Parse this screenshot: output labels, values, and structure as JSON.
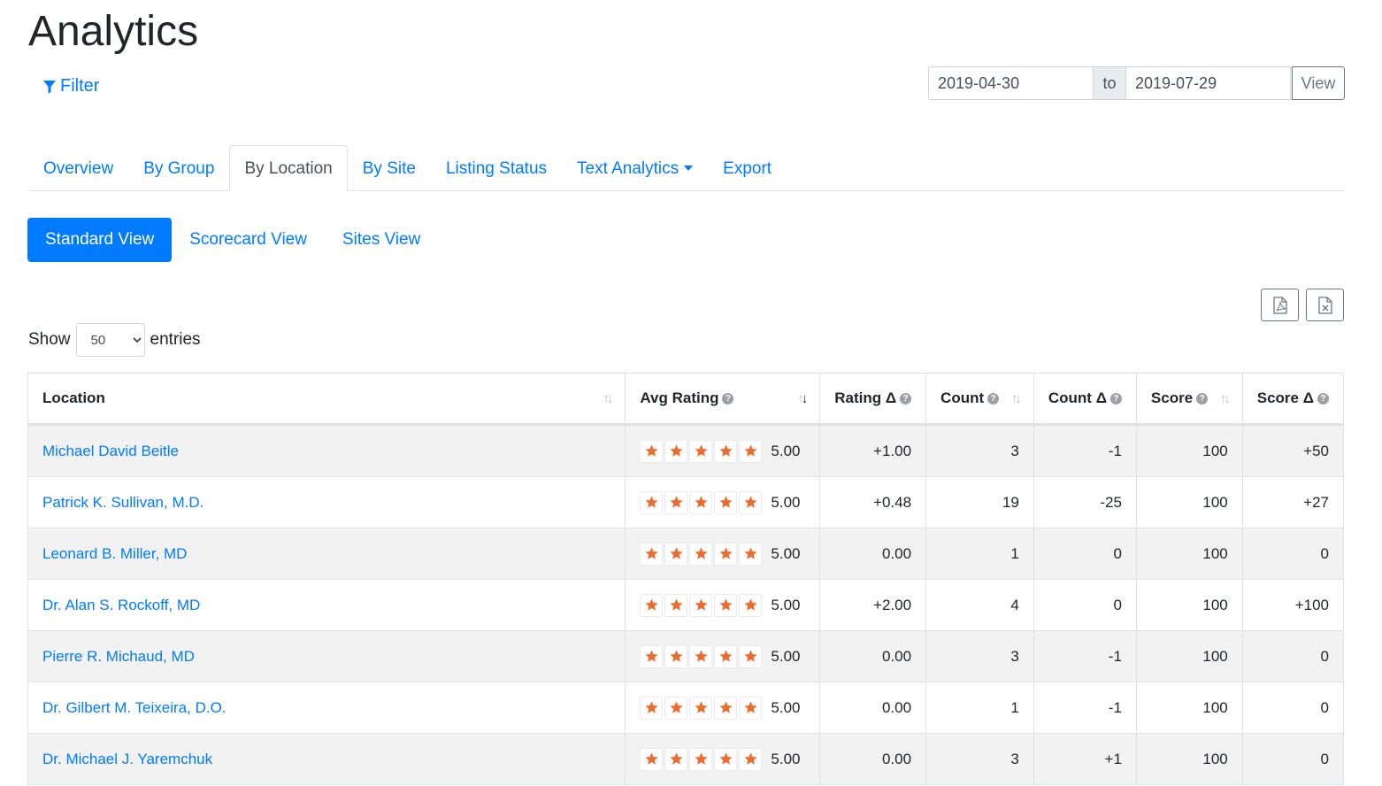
{
  "page": {
    "title": "Analytics",
    "filter_label": "Filter"
  },
  "date_range": {
    "start": "2019-04-30",
    "separator": "to",
    "end": "2019-07-29",
    "view_label": "View"
  },
  "tabs": [
    {
      "label": "Overview"
    },
    {
      "label": "By Group"
    },
    {
      "label": "By Location",
      "active": true
    },
    {
      "label": "By Site"
    },
    {
      "label": "Listing Status"
    },
    {
      "label": "Text Analytics",
      "dropdown": true
    },
    {
      "label": "Export"
    }
  ],
  "views": [
    {
      "label": "Standard View",
      "active": true
    },
    {
      "label": "Scorecard View"
    },
    {
      "label": "Sites View"
    }
  ],
  "exports": {
    "pdf_icon": "pdf-file-icon",
    "excel_icon": "excel-file-icon"
  },
  "entries": {
    "show_label": "Show",
    "value": "50",
    "suffix": "entries"
  },
  "colors": {
    "accent": "#007bff",
    "star": "#f06a2e",
    "positive": "#28a745",
    "negative": "#a52a2a"
  },
  "table": {
    "columns": [
      {
        "label": "Location",
        "help": false,
        "sort": "both"
      },
      {
        "label": "Avg Rating",
        "help": true,
        "sort": "desc"
      },
      {
        "label": "Rating Δ",
        "help": true,
        "sort": "none"
      },
      {
        "label": "Count",
        "help": true,
        "sort": "both"
      },
      {
        "label": "Count Δ",
        "help": true,
        "sort": "none"
      },
      {
        "label": "Score",
        "help": true,
        "sort": "both"
      },
      {
        "label": "Score Δ",
        "help": true,
        "sort": "none"
      }
    ],
    "rows": [
      {
        "location": "Michael David Beitle",
        "stars": 5,
        "avg_rating": "5.00",
        "rating_delta": "+1.00",
        "count": "3",
        "count_delta": "-1",
        "score": "100",
        "score_delta": "+50"
      },
      {
        "location": "Patrick K. Sullivan, M.D.",
        "stars": 5,
        "avg_rating": "5.00",
        "rating_delta": "+0.48",
        "count": "19",
        "count_delta": "-25",
        "score": "100",
        "score_delta": "+27"
      },
      {
        "location": "Leonard B. Miller, MD",
        "stars": 5,
        "avg_rating": "5.00",
        "rating_delta": "0.00",
        "count": "1",
        "count_delta": "0",
        "score": "100",
        "score_delta": "0"
      },
      {
        "location": "Dr. Alan S. Rockoff, MD",
        "stars": 5,
        "avg_rating": "5.00",
        "rating_delta": "+2.00",
        "count": "4",
        "count_delta": "0",
        "score": "100",
        "score_delta": "+100"
      },
      {
        "location": "Pierre R. Michaud, MD",
        "stars": 5,
        "avg_rating": "5.00",
        "rating_delta": "0.00",
        "count": "3",
        "count_delta": "-1",
        "score": "100",
        "score_delta": "0"
      },
      {
        "location": "Dr. Gilbert M. Teixeira, D.O.",
        "stars": 5,
        "avg_rating": "5.00",
        "rating_delta": "0.00",
        "count": "1",
        "count_delta": "-1",
        "score": "100",
        "score_delta": "0"
      },
      {
        "location": "Dr. Michael J. Yaremchuk",
        "stars": 5,
        "avg_rating": "5.00",
        "rating_delta": "0.00",
        "count": "3",
        "count_delta": "+1",
        "score": "100",
        "score_delta": "0"
      }
    ]
  }
}
